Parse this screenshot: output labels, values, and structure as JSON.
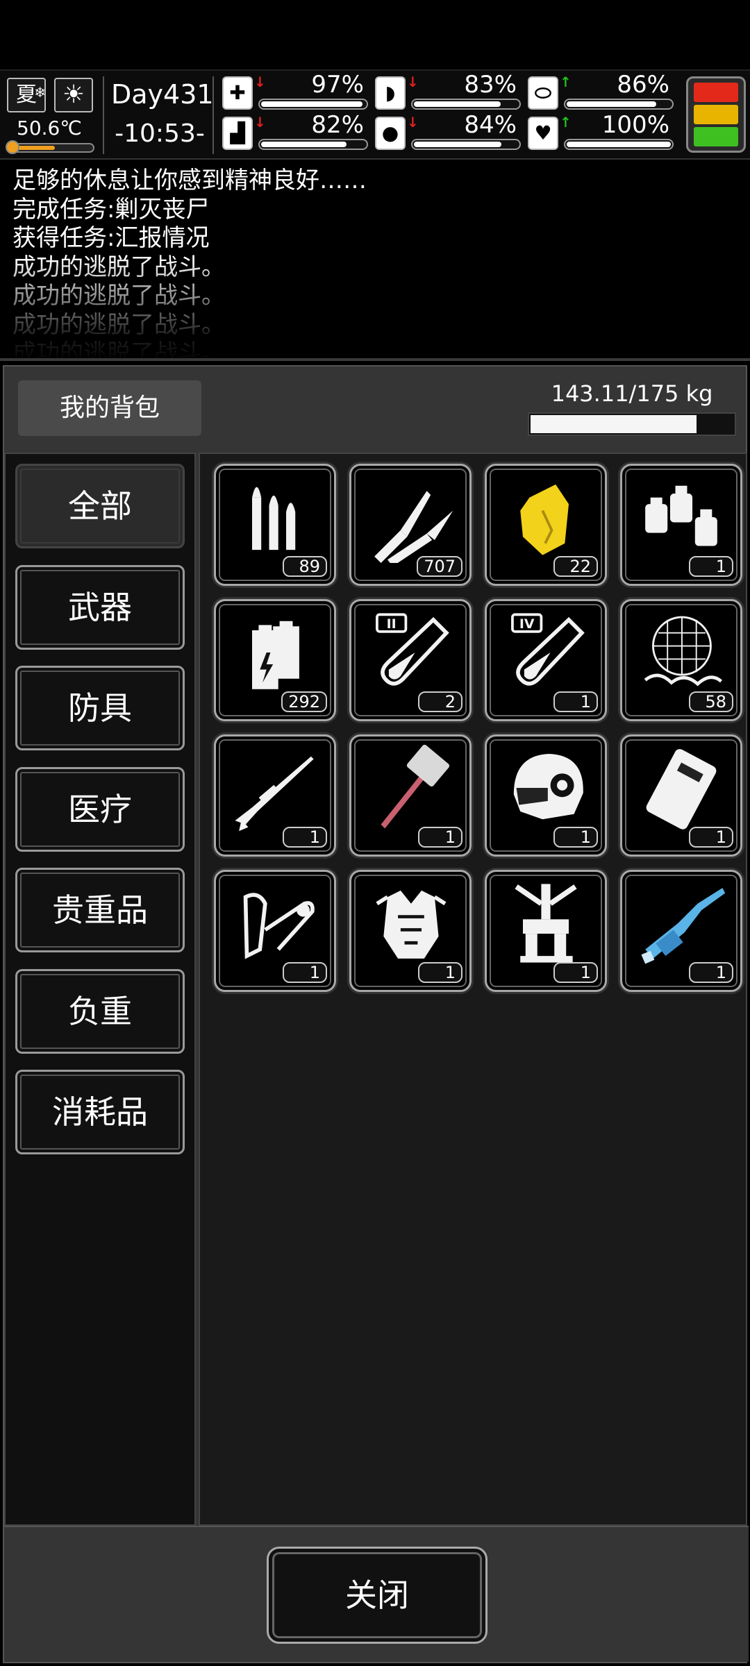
{
  "status": {
    "season": "夏",
    "temperature": "50.6℃",
    "temperature_level": 0.5,
    "day": "Day431",
    "time": "-10:53-",
    "stats": [
      {
        "name": "health",
        "icon": "medkit-icon",
        "value": "97%",
        "level": 0.97,
        "trend": "down"
      },
      {
        "name": "hunger",
        "icon": "stomach-icon",
        "value": "83%",
        "level": 0.83,
        "trend": "down"
      },
      {
        "name": "medicine",
        "icon": "pill-icon",
        "value": "86%",
        "level": 0.86,
        "trend": "up"
      },
      {
        "name": "stamina",
        "icon": "boot-icon",
        "value": "82%",
        "level": 0.82,
        "trend": "down"
      },
      {
        "name": "thirst",
        "icon": "water-drop-icon",
        "value": "84%",
        "level": 0.84,
        "trend": "down"
      },
      {
        "name": "mood",
        "icon": "heart-icon",
        "value": "100%",
        "level": 1.0,
        "trend": "up"
      }
    ],
    "indicator_colors": [
      "#e32a1a",
      "#e8b400",
      "#3ec021"
    ]
  },
  "log": [
    "足够的休息让你感到精神良好……",
    "完成任务:剿灭丧尸",
    "获得任务:汇报情况",
    "成功的逃脱了战斗。",
    "成功的逃脱了战斗。",
    "成功的逃脱了战斗。",
    "成功的逃脱了战斗。"
  ],
  "bag": {
    "title": "我的背包",
    "weight": "143.11/175 kg",
    "weight_fraction": 0.8177
  },
  "categories": [
    "全部",
    "武器",
    "防具",
    "医疗",
    "贵重品",
    "负重",
    "消耗品"
  ],
  "items": [
    {
      "icon": "ammo-bullets-icon",
      "qty": "89"
    },
    {
      "icon": "rifle-rounds-icon",
      "qty": "707"
    },
    {
      "icon": "gold-nugget-icon",
      "qty": "22"
    },
    {
      "icon": "fuel-cans-icon",
      "qty": "1"
    },
    {
      "icon": "batteries-icon",
      "qty": "292"
    },
    {
      "icon": "potion-tier-2-icon",
      "qty": "2"
    },
    {
      "icon": "potion-tier-4-icon",
      "qty": "1"
    },
    {
      "icon": "net-trap-icon",
      "qty": "58"
    },
    {
      "icon": "sniper-rifle-icon",
      "qty": "1"
    },
    {
      "icon": "war-hammer-icon",
      "qty": "1"
    },
    {
      "icon": "combat-helmet-icon",
      "qty": "1"
    },
    {
      "icon": "armor-plate-icon",
      "qty": "1"
    },
    {
      "icon": "arm-brace-icon",
      "qty": "1"
    },
    {
      "icon": "body-armor-icon",
      "qty": "1"
    },
    {
      "icon": "exoskeleton-legs-icon",
      "qty": "1"
    },
    {
      "icon": "minigun-icon",
      "qty": "1"
    }
  ],
  "close_label": "关闭"
}
